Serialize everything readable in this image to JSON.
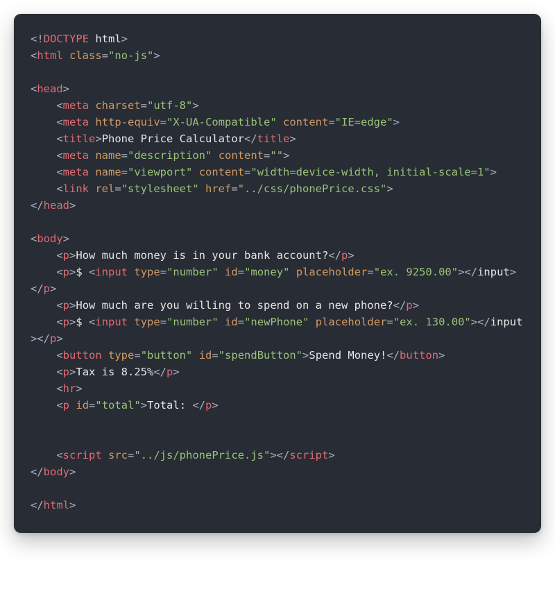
{
  "lines": [
    [
      {
        "t": "<!",
        "c": "grey"
      },
      {
        "t": "DOCTYPE",
        "c": "red"
      },
      {
        "t": " ",
        "c": "grey"
      },
      {
        "t": "html",
        "c": "white"
      },
      {
        "t": ">",
        "c": "grey"
      }
    ],
    [
      {
        "t": "<",
        "c": "grey"
      },
      {
        "t": "html",
        "c": "red"
      },
      {
        "t": " ",
        "c": "grey"
      },
      {
        "t": "class",
        "c": "orange"
      },
      {
        "t": "=",
        "c": "grey"
      },
      {
        "t": "\"no-js\"",
        "c": "green"
      },
      {
        "t": ">",
        "c": "grey"
      }
    ],
    [],
    [
      {
        "t": "<",
        "c": "grey"
      },
      {
        "t": "head",
        "c": "red"
      },
      {
        "t": ">",
        "c": "grey"
      }
    ],
    [
      {
        "t": "    <",
        "c": "grey"
      },
      {
        "t": "meta",
        "c": "red"
      },
      {
        "t": " ",
        "c": "grey"
      },
      {
        "t": "charset",
        "c": "orange"
      },
      {
        "t": "=",
        "c": "grey"
      },
      {
        "t": "\"utf-8\"",
        "c": "green"
      },
      {
        "t": ">",
        "c": "grey"
      }
    ],
    [
      {
        "t": "    <",
        "c": "grey"
      },
      {
        "t": "meta",
        "c": "red"
      },
      {
        "t": " ",
        "c": "grey"
      },
      {
        "t": "http-equiv",
        "c": "orange"
      },
      {
        "t": "=",
        "c": "grey"
      },
      {
        "t": "\"X-UA-Compatible\"",
        "c": "green"
      },
      {
        "t": " ",
        "c": "grey"
      },
      {
        "t": "content",
        "c": "orange"
      },
      {
        "t": "=",
        "c": "grey"
      },
      {
        "t": "\"IE=edge\"",
        "c": "green"
      },
      {
        "t": ">",
        "c": "grey"
      }
    ],
    [
      {
        "t": "    <",
        "c": "grey"
      },
      {
        "t": "title",
        "c": "red"
      },
      {
        "t": ">",
        "c": "grey"
      },
      {
        "t": "Phone Price Calculator",
        "c": "white"
      },
      {
        "t": "</",
        "c": "grey"
      },
      {
        "t": "title",
        "c": "red"
      },
      {
        "t": ">",
        "c": "grey"
      }
    ],
    [
      {
        "t": "    <",
        "c": "grey"
      },
      {
        "t": "meta",
        "c": "red"
      },
      {
        "t": " ",
        "c": "grey"
      },
      {
        "t": "name",
        "c": "orange"
      },
      {
        "t": "=",
        "c": "grey"
      },
      {
        "t": "\"description\"",
        "c": "green"
      },
      {
        "t": " ",
        "c": "grey"
      },
      {
        "t": "content",
        "c": "orange"
      },
      {
        "t": "=",
        "c": "grey"
      },
      {
        "t": "\"\"",
        "c": "green"
      },
      {
        "t": ">",
        "c": "grey"
      }
    ],
    [
      {
        "t": "    <",
        "c": "grey"
      },
      {
        "t": "meta",
        "c": "red"
      },
      {
        "t": " ",
        "c": "grey"
      },
      {
        "t": "name",
        "c": "orange"
      },
      {
        "t": "=",
        "c": "grey"
      },
      {
        "t": "\"viewport\"",
        "c": "green"
      },
      {
        "t": " ",
        "c": "grey"
      },
      {
        "t": "content",
        "c": "orange"
      },
      {
        "t": "=",
        "c": "grey"
      },
      {
        "t": "\"width=device-width, initial-scale=1\"",
        "c": "green"
      },
      {
        "t": ">",
        "c": "grey"
      }
    ],
    [
      {
        "t": "    <",
        "c": "grey"
      },
      {
        "t": "link",
        "c": "red"
      },
      {
        "t": " ",
        "c": "grey"
      },
      {
        "t": "rel",
        "c": "orange"
      },
      {
        "t": "=",
        "c": "grey"
      },
      {
        "t": "\"stylesheet\"",
        "c": "green"
      },
      {
        "t": " ",
        "c": "grey"
      },
      {
        "t": "href",
        "c": "orange"
      },
      {
        "t": "=",
        "c": "grey"
      },
      {
        "t": "\"../css/phonePrice.css\"",
        "c": "green"
      },
      {
        "t": ">",
        "c": "grey"
      }
    ],
    [
      {
        "t": "</",
        "c": "grey"
      },
      {
        "t": "head",
        "c": "red"
      },
      {
        "t": ">",
        "c": "grey"
      }
    ],
    [],
    [
      {
        "t": "<",
        "c": "grey"
      },
      {
        "t": "body",
        "c": "red"
      },
      {
        "t": ">",
        "c": "grey"
      }
    ],
    [
      {
        "t": "    <",
        "c": "grey"
      },
      {
        "t": "p",
        "c": "red"
      },
      {
        "t": ">",
        "c": "grey"
      },
      {
        "t": "How much money is in your bank account?",
        "c": "white"
      },
      {
        "t": "</",
        "c": "grey"
      },
      {
        "t": "p",
        "c": "red"
      },
      {
        "t": ">",
        "c": "grey"
      }
    ],
    [
      {
        "t": "    <",
        "c": "grey"
      },
      {
        "t": "p",
        "c": "red"
      },
      {
        "t": ">",
        "c": "grey"
      },
      {
        "t": "$ ",
        "c": "white"
      },
      {
        "t": "<",
        "c": "grey"
      },
      {
        "t": "input",
        "c": "red"
      },
      {
        "t": " ",
        "c": "grey"
      },
      {
        "t": "type",
        "c": "orange"
      },
      {
        "t": "=",
        "c": "grey"
      },
      {
        "t": "\"number\"",
        "c": "green"
      },
      {
        "t": " ",
        "c": "grey"
      },
      {
        "t": "id",
        "c": "orange"
      },
      {
        "t": "=",
        "c": "grey"
      },
      {
        "t": "\"money\"",
        "c": "green"
      },
      {
        "t": " ",
        "c": "grey"
      },
      {
        "t": "placeholder",
        "c": "orange"
      },
      {
        "t": "=",
        "c": "grey"
      },
      {
        "t": "\"ex. 9250.00\"",
        "c": "green"
      },
      {
        "t": ">",
        "c": "grey"
      },
      {
        "t": "</",
        "c": "grey"
      },
      {
        "t": "input",
        "c": "white"
      },
      {
        "t": ">",
        "c": "grey"
      },
      {
        "t": "</",
        "c": "grey"
      },
      {
        "t": "p",
        "c": "red"
      },
      {
        "t": ">",
        "c": "grey"
      }
    ],
    [
      {
        "t": "    <",
        "c": "grey"
      },
      {
        "t": "p",
        "c": "red"
      },
      {
        "t": ">",
        "c": "grey"
      },
      {
        "t": "How much are you willing to spend on a new phone?",
        "c": "white"
      },
      {
        "t": "</",
        "c": "grey"
      },
      {
        "t": "p",
        "c": "red"
      },
      {
        "t": ">",
        "c": "grey"
      }
    ],
    [
      {
        "t": "    <",
        "c": "grey"
      },
      {
        "t": "p",
        "c": "red"
      },
      {
        "t": ">",
        "c": "grey"
      },
      {
        "t": "$ ",
        "c": "white"
      },
      {
        "t": "<",
        "c": "grey"
      },
      {
        "t": "input",
        "c": "red"
      },
      {
        "t": " ",
        "c": "grey"
      },
      {
        "t": "type",
        "c": "orange"
      },
      {
        "t": "=",
        "c": "grey"
      },
      {
        "t": "\"number\"",
        "c": "green"
      },
      {
        "t": " ",
        "c": "grey"
      },
      {
        "t": "id",
        "c": "orange"
      },
      {
        "t": "=",
        "c": "grey"
      },
      {
        "t": "\"newPhone\"",
        "c": "green"
      },
      {
        "t": " ",
        "c": "grey"
      },
      {
        "t": "placeholder",
        "c": "orange"
      },
      {
        "t": "=",
        "c": "grey"
      },
      {
        "t": "\"ex. 130.00\"",
        "c": "green"
      },
      {
        "t": ">",
        "c": "grey"
      },
      {
        "t": "</",
        "c": "grey"
      },
      {
        "t": "input",
        "c": "white"
      },
      {
        "t": ">",
        "c": "grey"
      },
      {
        "t": "</",
        "c": "grey"
      },
      {
        "t": "p",
        "c": "red"
      },
      {
        "t": ">",
        "c": "grey"
      }
    ],
    [
      {
        "t": "    <",
        "c": "grey"
      },
      {
        "t": "button",
        "c": "red"
      },
      {
        "t": " ",
        "c": "grey"
      },
      {
        "t": "type",
        "c": "orange"
      },
      {
        "t": "=",
        "c": "grey"
      },
      {
        "t": "\"button\"",
        "c": "green"
      },
      {
        "t": " ",
        "c": "grey"
      },
      {
        "t": "id",
        "c": "orange"
      },
      {
        "t": "=",
        "c": "grey"
      },
      {
        "t": "\"spendButton\"",
        "c": "green"
      },
      {
        "t": ">",
        "c": "grey"
      },
      {
        "t": "Spend Money!",
        "c": "white"
      },
      {
        "t": "</",
        "c": "grey"
      },
      {
        "t": "button",
        "c": "red"
      },
      {
        "t": ">",
        "c": "grey"
      }
    ],
    [
      {
        "t": "    <",
        "c": "grey"
      },
      {
        "t": "p",
        "c": "red"
      },
      {
        "t": ">",
        "c": "grey"
      },
      {
        "t": "Tax is 8.25%",
        "c": "white"
      },
      {
        "t": "</",
        "c": "grey"
      },
      {
        "t": "p",
        "c": "red"
      },
      {
        "t": ">",
        "c": "grey"
      }
    ],
    [
      {
        "t": "    <",
        "c": "grey"
      },
      {
        "t": "hr",
        "c": "red"
      },
      {
        "t": ">",
        "c": "grey"
      }
    ],
    [
      {
        "t": "    <",
        "c": "grey"
      },
      {
        "t": "p",
        "c": "red"
      },
      {
        "t": " ",
        "c": "grey"
      },
      {
        "t": "id",
        "c": "orange"
      },
      {
        "t": "=",
        "c": "grey"
      },
      {
        "t": "\"total\"",
        "c": "green"
      },
      {
        "t": ">",
        "c": "grey"
      },
      {
        "t": "Total: ",
        "c": "white"
      },
      {
        "t": "</",
        "c": "grey"
      },
      {
        "t": "p",
        "c": "red"
      },
      {
        "t": ">",
        "c": "grey"
      }
    ],
    [],
    [],
    [
      {
        "t": "    <",
        "c": "grey"
      },
      {
        "t": "script",
        "c": "red"
      },
      {
        "t": " ",
        "c": "grey"
      },
      {
        "t": "src",
        "c": "orange"
      },
      {
        "t": "=",
        "c": "grey"
      },
      {
        "t": "\"../js/phonePrice.js\"",
        "c": "green"
      },
      {
        "t": ">",
        "c": "grey"
      },
      {
        "t": "</",
        "c": "grey"
      },
      {
        "t": "script",
        "c": "red"
      },
      {
        "t": ">",
        "c": "grey"
      }
    ],
    [
      {
        "t": "</",
        "c": "grey"
      },
      {
        "t": "body",
        "c": "red"
      },
      {
        "t": ">",
        "c": "grey"
      }
    ],
    [],
    [
      {
        "t": "</",
        "c": "grey"
      },
      {
        "t": "html",
        "c": "red"
      },
      {
        "t": ">",
        "c": "grey"
      }
    ]
  ]
}
